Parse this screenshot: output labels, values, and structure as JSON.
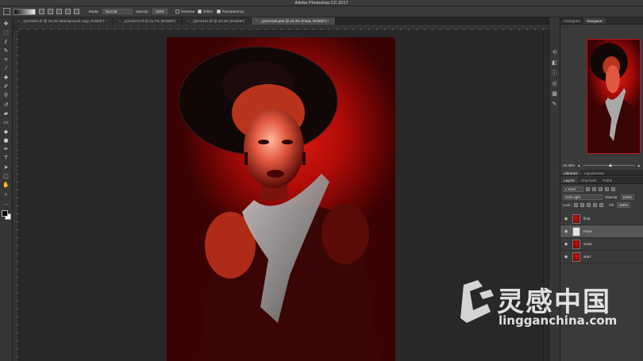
{
  "app": {
    "title": "Adobe Photoshop CC 2017"
  },
  "options_bar": {
    "mode_label": "Mode:",
    "mode_value": "Normal",
    "opacity_label": "Opacity:",
    "opacity_value": "100%",
    "reverse_label": "Reverse",
    "reverse_checked": false,
    "dither_label": "Dither",
    "dither_checked": true,
    "transparency_label": "Transparency",
    "transparency_checked": true
  },
  "documents": [
    {
      "label": "_Q2A0001.tif @ 33.3% (Background copy, RGB/8*) *",
      "active": false
    },
    {
      "label": "_Q2A0374.tif @ 31.7% (RGB/8*)",
      "active": false
    },
    {
      "label": "_Q2A0161.tif @ 33.3% (RGB/8*)",
      "active": false
    },
    {
      "label": "_Q2A0180.psd @ 33.3% (Fava, RGB/8*) *",
      "active": true
    }
  ],
  "tools": [
    "move-tool-icon",
    "marquee-tool-icon",
    "lasso-tool-icon",
    "quick-select-tool-icon",
    "crop-tool-icon",
    "eyedropper-tool-icon",
    "healing-brush-tool-icon",
    "brush-tool-icon",
    "clone-stamp-tool-icon",
    "history-brush-tool-icon",
    "eraser-tool-icon",
    "gradient-tool-icon",
    "blur-tool-icon",
    "dodge-tool-icon",
    "pen-tool-icon",
    "type-tool-icon",
    "path-select-tool-icon",
    "rectangle-tool-icon",
    "hand-tool-icon",
    "zoom-tool-icon",
    "more-tools-icon"
  ],
  "panels": {
    "top_tabs": [
      "Histogram",
      "Navigator"
    ],
    "active_top_tab": "Navigator",
    "zoom_value": "33.48%",
    "zoom_level": 0.5,
    "lib_tabs": [
      "Libraries",
      "Adjustments"
    ],
    "layer_tabs": [
      "Layers",
      "Channels",
      "Paths"
    ],
    "kind_label": "Kind",
    "blend_mode": "Soft Light",
    "opacity_label": "Opacity:",
    "opacity_value": "100%",
    "lock_label": "Lock:",
    "fill_label": "Fill:",
    "fill_value": "100%"
  },
  "layers": [
    {
      "name": "final",
      "selected": false,
      "mask": false
    },
    {
      "name": "Fava",
      "selected": true,
      "mask": true
    },
    {
      "name": "clean",
      "selected": false,
      "mask": false
    },
    {
      "name": "start",
      "selected": false,
      "mask": false
    }
  ],
  "watermark": {
    "chinese": "灵感中国",
    "domain": "lingganchina.com"
  },
  "colors": {
    "accent_red": "#d0140c",
    "ui_dark": "#2b2b2b",
    "panel": "#3a3a3a"
  }
}
